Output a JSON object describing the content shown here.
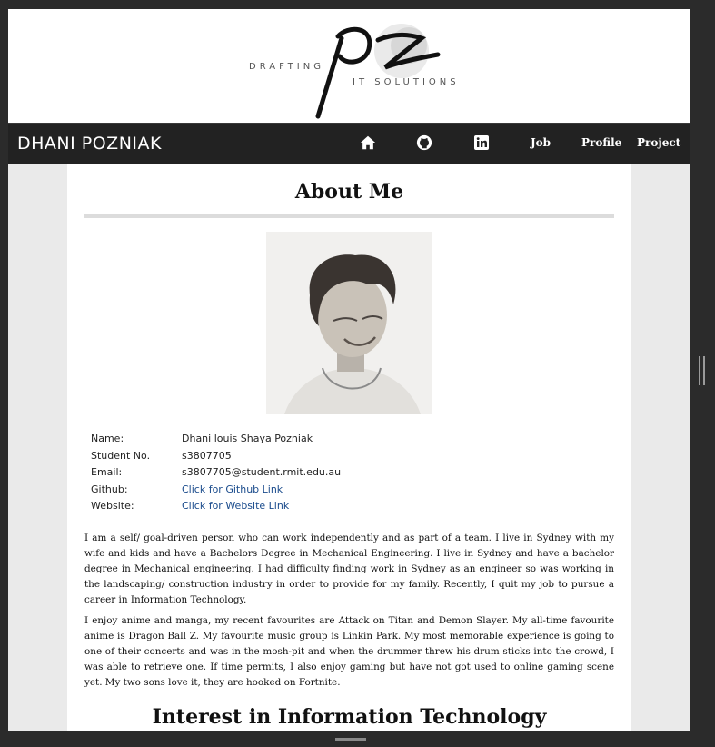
{
  "logo": {
    "mark_text": "pz",
    "word_left": "DRAFTING",
    "word_right": "IT SOLUTIONS"
  },
  "navbar": {
    "brand": "DHANI POZNIAK",
    "icons": [
      "home-icon",
      "github-icon",
      "linkedin-icon"
    ],
    "links": [
      "Job",
      "Profile",
      "Project"
    ]
  },
  "about": {
    "heading": "About Me",
    "info": [
      {
        "label": "Name:",
        "value": "Dhani louis Shaya Pozniak"
      },
      {
        "label": "Student No.",
        "value": "s3807705"
      },
      {
        "label": "Email:",
        "value": "s3807705@student.rmit.edu.au"
      },
      {
        "label": "Github:",
        "value": "Click for Github Link"
      },
      {
        "label": "Website:",
        "value": "Click for Website Link"
      }
    ],
    "paragraphs": [
      "I am a self/ goal-driven person who can work independently and as part of a team. I live in Sydney with my wife and kids and have a Bachelors Degree in Mechanical Engineering. I live in Sydney and have a bachelor degree in Mechanical engineering. I had difficulty finding work in Sydney as an engineer so was working in the landscaping/ construction industry in order to provide for my family. Recently, I quit my job to pursue a career in Information Technology.",
      "I enjoy anime and manga, my recent favourites are Attack on Titan and Demon Slayer. My all-time favourite anime is Dragon Ball Z. My favourite music group is Linkin Park. My most memorable experience is going to one of their concerts and was in the mosh-pit and when the drummer threw his drum sticks into the crowd, I was able to retrieve one. If time permits, I also enjoy gaming but have not got used to online gaming scene yet. My two sons love it, they are hooked on Fortnite."
    ]
  },
  "interest": {
    "heading": "Interest in Information Technology"
  },
  "colors": {
    "navbar_bg": "#222222",
    "page_bg": "#eaeaea",
    "link": "#1a4b8c"
  }
}
